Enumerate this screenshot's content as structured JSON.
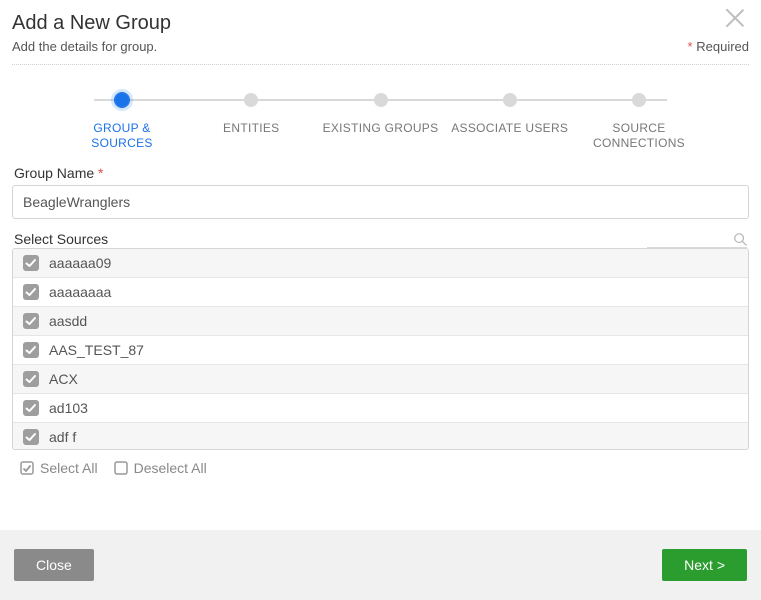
{
  "header": {
    "title": "Add a New Group",
    "subtitle": "Add the details for group.",
    "required_marker": "*",
    "required_word": "Required"
  },
  "wizard": {
    "steps": [
      {
        "label": "GROUP & SOURCES",
        "active": true
      },
      {
        "label": "ENTITIES",
        "active": false
      },
      {
        "label": "EXISTING GROUPS",
        "active": false
      },
      {
        "label": "ASSOCIATE USERS",
        "active": false
      },
      {
        "label": "SOURCE CONNECTIONS",
        "active": false
      }
    ]
  },
  "form": {
    "group_name_label": "Group Name",
    "group_name_required_marker": "*",
    "group_name_value": "BeagleWranglers",
    "select_sources_label": "Select Sources"
  },
  "sources": [
    {
      "name": "aaaaaa09",
      "checked": true
    },
    {
      "name": "aaaaaaaa",
      "checked": true
    },
    {
      "name": "aasdd",
      "checked": true
    },
    {
      "name": "AAS_TEST_87",
      "checked": true
    },
    {
      "name": "ACX",
      "checked": true
    },
    {
      "name": "ad103",
      "checked": true
    },
    {
      "name": "adf  f",
      "checked": true
    }
  ],
  "bulk": {
    "select_all": "Select All",
    "deselect_all": "Deselect All"
  },
  "footer": {
    "close": "Close",
    "next": "Next >"
  }
}
